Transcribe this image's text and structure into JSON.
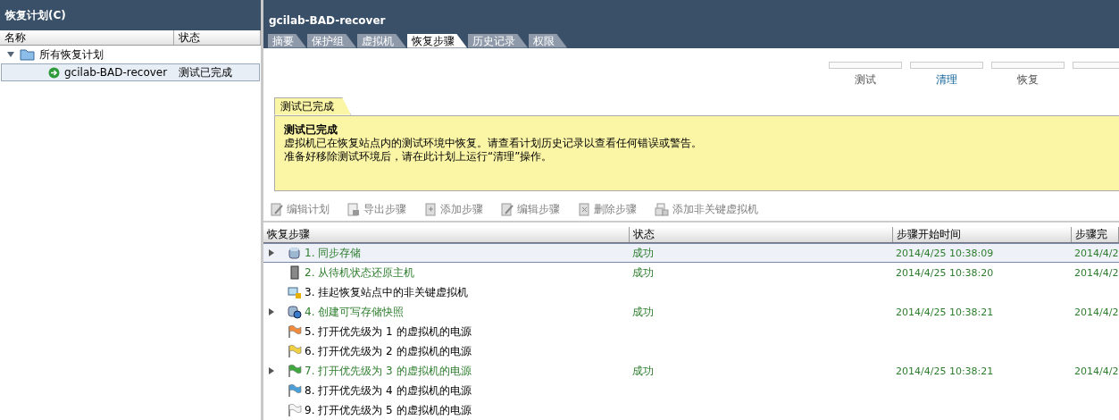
{
  "plans_panel": {
    "title": "恢复计划(C)",
    "columns": [
      "名称",
      "状态"
    ],
    "tree": [
      {
        "label": "所有恢复计划",
        "expanded": true,
        "children": [
          {
            "label": "gcilab-BAD-recover",
            "status": "测试已完成",
            "selected": true
          }
        ]
      }
    ]
  },
  "detail": {
    "title": "gcilab-BAD-recover",
    "tabs": [
      {
        "label": "摘要",
        "selected": false
      },
      {
        "label": "保护组",
        "selected": false
      },
      {
        "label": "虚拟机",
        "selected": false
      },
      {
        "label": "恢复步骤",
        "selected": true
      },
      {
        "label": "历史记录",
        "selected": false
      },
      {
        "label": "权限",
        "selected": false
      }
    ],
    "stages": [
      {
        "label": "测试",
        "highlighted": false,
        "level": 0
      },
      {
        "label": "清理",
        "highlighted": true,
        "level": 0
      },
      {
        "label": "恢复",
        "highlighted": false,
        "level": 0
      },
      {
        "level": 0
      }
    ],
    "notice": {
      "tab": "测试已完成",
      "heading": "测试已完成",
      "lines": [
        "虚拟机已在恢复站点内的测试环境中恢复。请查看计划历史记录以查看任何错误或警告。",
        "准备好移除测试环境后，请在此计划上运行“清理”操作。"
      ]
    },
    "toolbar": [
      {
        "label": "编辑计划",
        "kind": "edit-plan",
        "disabled": true
      },
      {
        "label": "导出步骤",
        "kind": "export",
        "disabled": true
      },
      {
        "label": "添加步骤",
        "kind": "add",
        "disabled": true
      },
      {
        "label": "编辑步骤",
        "kind": "edit",
        "disabled": true
      },
      {
        "label": "删除步骤",
        "kind": "delete",
        "disabled": true
      },
      {
        "label": "添加非关键虚拟机",
        "kind": "add-vm",
        "disabled": true
      }
    ],
    "table": {
      "columns": [
        "恢复步骤",
        "状态",
        "步骤开始时间",
        "步骤完"
      ],
      "rows": [
        {
          "step": "1. 同步存储",
          "kind": "storage",
          "expandable": true,
          "completed": true,
          "selected": true,
          "status": "成功",
          "start": "2014/4/25 10:38:09",
          "end": "2014/4/2"
        },
        {
          "step": "2. 从待机状态还原主机",
          "kind": "host",
          "expandable": false,
          "completed": true,
          "selected": false,
          "status": "成功",
          "start": "2014/4/25 10:38:20",
          "end": "2014/4/2"
        },
        {
          "step": "3. 挂起恢复站点中的非关键虚拟机",
          "kind": "suspend",
          "expandable": false,
          "completed": false,
          "selected": false
        },
        {
          "step": "4. 创建可写存储快照",
          "kind": "snapshot",
          "expandable": true,
          "completed": true,
          "selected": false,
          "status": "成功",
          "start": "2014/4/25 10:38:21",
          "end": "2014/4/2"
        },
        {
          "step": "5. 打开优先级为 1 的虚拟机的电源",
          "kind": "flag",
          "color": "#f08a3c",
          "expandable": false,
          "completed": false,
          "selected": false
        },
        {
          "step": "6. 打开优先级为 2 的虚拟机的电源",
          "kind": "flag",
          "color": "#f0d040",
          "expandable": false,
          "completed": false,
          "selected": false
        },
        {
          "step": "7. 打开优先级为 3 的虚拟机的电源",
          "kind": "flag",
          "color": "#3fa83f",
          "expandable": true,
          "completed": true,
          "selected": false,
          "status": "成功",
          "start": "2014/4/25 10:38:21",
          "end": "2014/4/2"
        },
        {
          "step": "8. 打开优先级为 4 的虚拟机的电源",
          "kind": "flag",
          "color": "#4a9fd8",
          "expandable": false,
          "completed": false,
          "selected": false
        },
        {
          "step": "9. 打开优先级为 5 的虚拟机的电源",
          "kind": "flag",
          "color": "#f4f4f4",
          "expandable": false,
          "completed": false,
          "selected": false
        }
      ]
    }
  }
}
